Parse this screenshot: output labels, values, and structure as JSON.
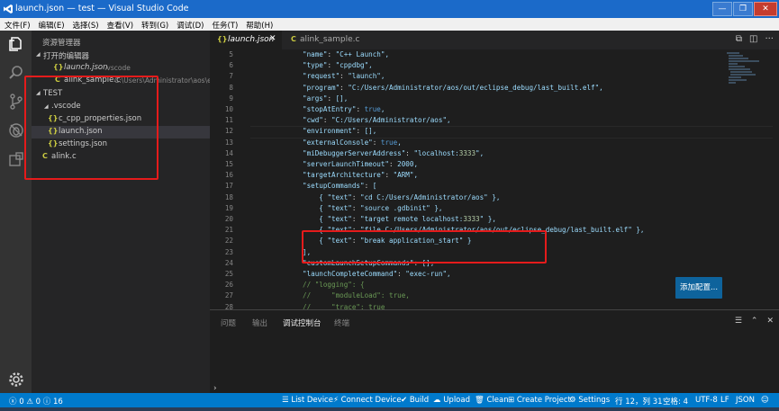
{
  "window": {
    "title": "launch.json — test — Visual Studio Code",
    "btn_min": "—",
    "btn_max": "❐",
    "btn_close": "✕"
  },
  "menu": [
    "文件(F)",
    "编辑(E)",
    "选择(S)",
    "查看(V)",
    "转到(G)",
    "调试(D)",
    "任务(T)",
    "帮助(H)"
  ],
  "sidebar": {
    "header": "资源管理器",
    "open_editors": {
      "label": "打开的编辑器",
      "items": [
        {
          "icon": "{}",
          "name": "launch.json",
          "sub": ".vscode"
        },
        {
          "icon": "C",
          "name": "alink_sample.c",
          "sub": "C:\\Users\\Administrator\\aos\\e..."
        }
      ]
    },
    "folder": {
      "label": "TEST",
      "items": [
        {
          "icon": "",
          "name": ".vscode"
        },
        {
          "icon": "{}",
          "name": "c_cpp_properties.json"
        },
        {
          "icon": "{}",
          "name": "launch.json"
        },
        {
          "icon": "{}",
          "name": "settings.json"
        },
        {
          "icon": "C",
          "name": "alink.c"
        }
      ]
    }
  },
  "tabs": [
    {
      "icon": "{}",
      "label": "launch.json",
      "close": "✕"
    },
    {
      "icon": "C",
      "label": "alink_sample.c"
    }
  ],
  "editor": {
    "lines": [
      {
        "n": "5",
        "t": "\"name\": \"C++ Launch\","
      },
      {
        "n": "6",
        "t": "\"type\": \"cppdbg\","
      },
      {
        "n": "7",
        "t": "\"request\": \"launch\","
      },
      {
        "n": "8",
        "t": "\"program\": \"C:/Users/Administrator/aos/out/eclipse_debug/last_built.elf\","
      },
      {
        "n": "9",
        "t": "\"args\": [],"
      },
      {
        "n": "10",
        "t": "\"stopAtEntry\": true,"
      },
      {
        "n": "11",
        "t": "\"cwd\": \"C:/Users/Administrator/aos\","
      },
      {
        "n": "12",
        "t": "\"environment\": [],"
      },
      {
        "n": "13",
        "t": "\"externalConsole\": true,"
      },
      {
        "n": "14",
        "t": "\"miDebuggerServerAddress\": \"localhost:3333\","
      },
      {
        "n": "15",
        "t": "\"serverLaunchTimeout\": 2000,"
      },
      {
        "n": "16",
        "t": "\"targetArchitecture\": \"ARM\","
      },
      {
        "n": "17",
        "t": "\"setupCommands\": ["
      },
      {
        "n": "18",
        "t": "    { \"text\": \"cd C:/Users/Administrator/aos\" },"
      },
      {
        "n": "19",
        "t": "    { \"text\": \"source .gdbinit\" },"
      },
      {
        "n": "20",
        "t": "    { \"text\": \"target remote localhost:3333\" },"
      },
      {
        "n": "21",
        "t": "    { \"text\": \"file C:/Users/Administrator/aos/out/eclipse_debug/last_built.elf\" },"
      },
      {
        "n": "22",
        "t": "    { \"text\": \"break application_start\" }"
      },
      {
        "n": "23",
        "t": "],"
      },
      {
        "n": "24",
        "t": "\"customLaunchSetupCommands\": [],"
      },
      {
        "n": "25",
        "t": "\"launchCompleteCommand\": \"exec-run\","
      },
      {
        "n": "26",
        "t": "// \"logging\": {"
      },
      {
        "n": "27",
        "t": "//     \"moduleLoad\": true,"
      },
      {
        "n": "28",
        "t": "//     \"trace\": true"
      }
    ],
    "add_config_button": "添加配置..."
  },
  "panel": {
    "tabs": [
      "问题",
      "输出",
      "调试控制台",
      "终端"
    ],
    "active_tab": "调试控制台",
    "prompt": "›"
  },
  "statusbar": {
    "errors": "0",
    "warnings": "0",
    "info": "16",
    "items": [
      "List Device",
      "Connect Device",
      "Build",
      "Upload",
      "Clean",
      "Create Project",
      "Settings"
    ],
    "position": "行 12，列 31",
    "indent": "空格: 4",
    "encoding": "UTF-8",
    "eol": "LF",
    "language": "JSON"
  },
  "colors": {
    "accent": "#007acc",
    "title": "#1b6ac9",
    "highlight_box": "#e51b1b"
  }
}
